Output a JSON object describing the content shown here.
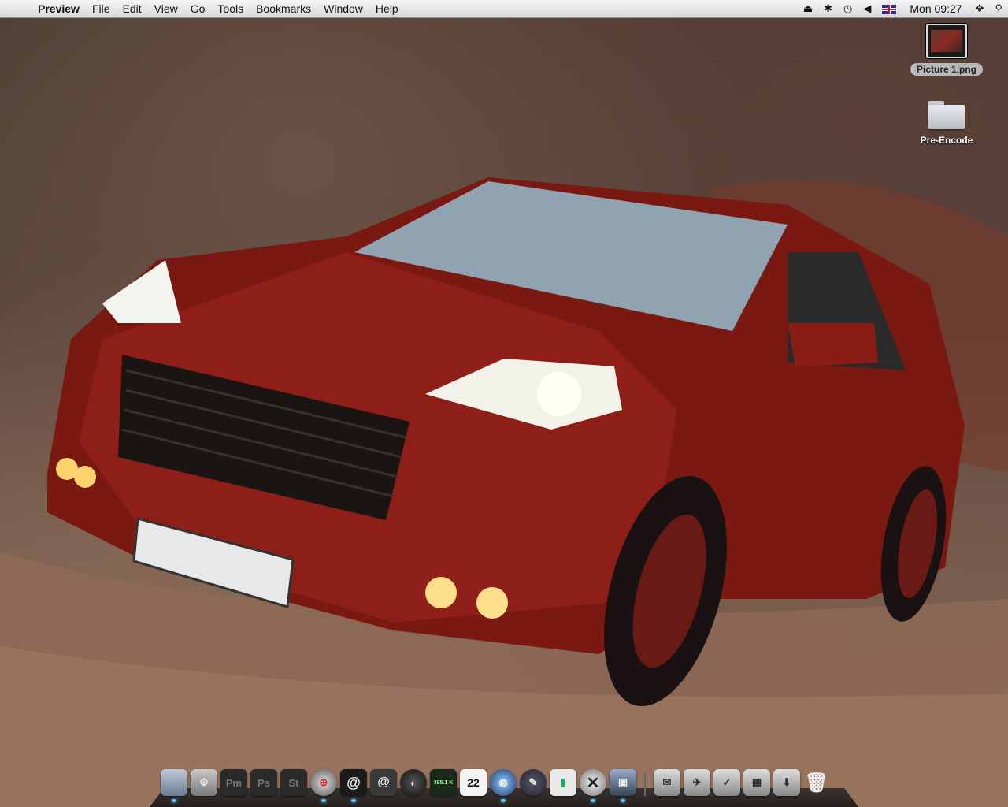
{
  "menubar": {
    "app_name": "Preview",
    "menus": [
      "File",
      "Edit",
      "View",
      "Go",
      "Tools",
      "Bookmarks",
      "Window",
      "Help"
    ],
    "clock": "Mon 09:27",
    "status_icons": [
      "eject-icon",
      "bluetooth-icon",
      "time-machine-icon",
      "volume-icon",
      "flag-uk-icon",
      "spaces-icon",
      "spotlight-icon"
    ]
  },
  "desktop": {
    "icons": [
      {
        "label": "Picture 1.png",
        "type": "image-thumbnail",
        "selected": true
      },
      {
        "label": "Pre-Encode",
        "type": "folder",
        "selected": false
      }
    ]
  },
  "dock": {
    "items": [
      {
        "name": "finder",
        "glyph": "",
        "running": true
      },
      {
        "name": "system-preferences",
        "glyph": "⚙",
        "running": false
      },
      {
        "name": "app-pm",
        "glyph": "Pm",
        "running": false
      },
      {
        "name": "app-ps",
        "glyph": "Ps",
        "running": false
      },
      {
        "name": "app-st",
        "glyph": "St",
        "running": false
      },
      {
        "name": "safari",
        "glyph": "⊕",
        "running": true
      },
      {
        "name": "mail",
        "glyph": "@",
        "running": true
      },
      {
        "name": "mail-2",
        "glyph": "@",
        "running": false
      },
      {
        "name": "app-disc",
        "glyph": "◐",
        "running": false
      },
      {
        "name": "network-monitor",
        "glyph": "385.1 K",
        "running": false
      },
      {
        "name": "ical",
        "glyph": "22",
        "running": false
      },
      {
        "name": "network-globe",
        "glyph": "◍",
        "running": true
      },
      {
        "name": "script-editor",
        "glyph": "✎",
        "running": false
      },
      {
        "name": "numbers-chart",
        "glyph": "▮",
        "running": false
      },
      {
        "name": "x-app",
        "glyph": "✕",
        "running": true
      },
      {
        "name": "preview",
        "glyph": "▣",
        "running": true
      }
    ],
    "stacks": [
      {
        "name": "mail-stack",
        "glyph": "✉"
      },
      {
        "name": "applications-stack",
        "glyph": "✈"
      },
      {
        "name": "documents-stack",
        "glyph": "✓"
      },
      {
        "name": "box-stack",
        "glyph": "▦"
      },
      {
        "name": "downloads-stack",
        "glyph": "⬇"
      },
      {
        "name": "trash",
        "glyph": "🗑"
      }
    ]
  }
}
